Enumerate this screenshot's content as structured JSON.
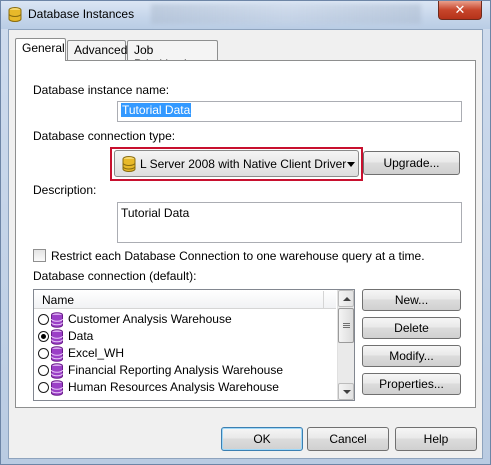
{
  "window": {
    "title": "Database Instances",
    "close_label": "✕"
  },
  "tabs": [
    {
      "label": "General",
      "active": true
    },
    {
      "label": "Advanced",
      "active": false
    },
    {
      "label": "Job Prioritization",
      "active": false
    }
  ],
  "general": {
    "instance_name_label": "Database instance name:",
    "instance_name_value": "Tutorial Data",
    "connection_type_label": "Database connection type:",
    "connection_type_value": "L Server 2008 with Native Client Driver",
    "upgrade_label": "Upgrade...",
    "description_label": "Description:",
    "description_value": "Tutorial Data",
    "restrict_label": "Restrict each Database Connection to one warehouse query at a time.",
    "restrict_checked": false,
    "connection_default_label": "Database connection (default):",
    "list_header": "Name",
    "connections": [
      {
        "name": "Customer Analysis Warehouse",
        "selected": false
      },
      {
        "name": "Data",
        "selected": true
      },
      {
        "name": "Excel_WH",
        "selected": false
      },
      {
        "name": "Financial Reporting Analysis Warehouse",
        "selected": false
      },
      {
        "name": "Human Resources Analysis Warehouse",
        "selected": false
      }
    ],
    "new_label": "New...",
    "delete_label": "Delete",
    "modify_label": "Modify...",
    "properties_label": "Properties..."
  },
  "footer": {
    "ok_label": "OK",
    "cancel_label": "Cancel",
    "help_label": "Help"
  },
  "colors": {
    "highlight_border": "#c8102e",
    "selection": "#3399ff"
  }
}
